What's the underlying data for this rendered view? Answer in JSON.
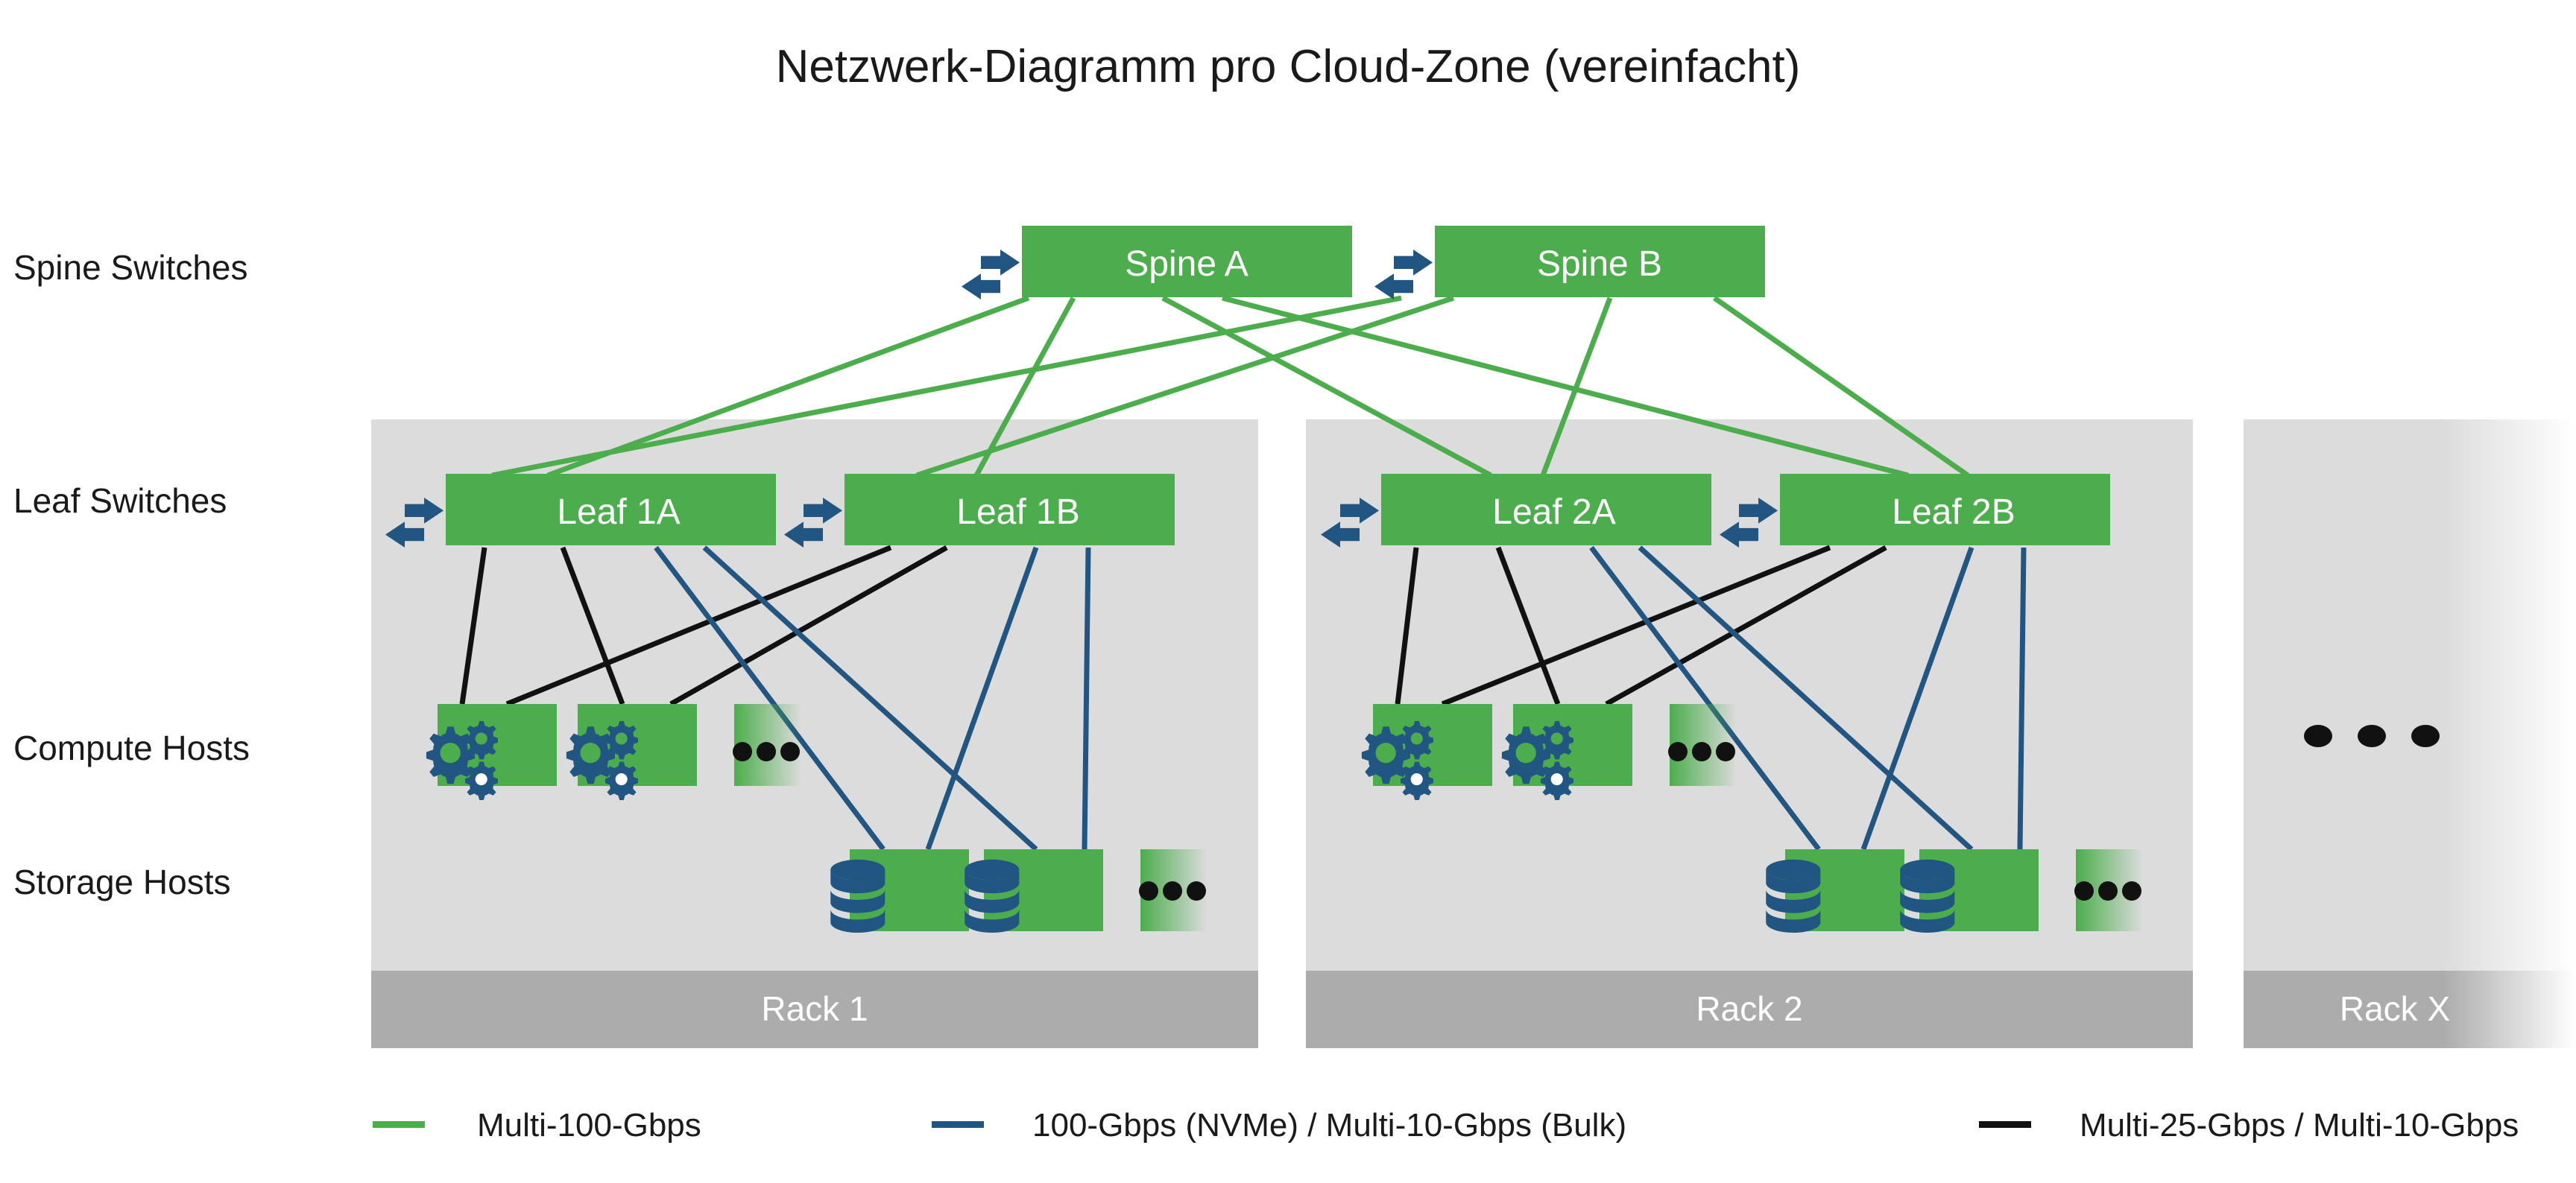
{
  "title": "Netzwerk-Diagramm pro Cloud-Zone (vereinfacht)",
  "colors": {
    "green": "#4CAD4C",
    "blue": "#215582",
    "black": "#111111",
    "rack_body": "#DCDCDC",
    "rack_footer": "#ACACAC",
    "background": "#FFFFFF",
    "text": "#1A1A1A"
  },
  "row_labels": [
    {
      "id": "spine",
      "label": "Spine Switches"
    },
    {
      "id": "leaf",
      "label": "Leaf Switches"
    },
    {
      "id": "compute",
      "label": "Compute Hosts"
    },
    {
      "id": "storage",
      "label": "Storage Hosts"
    }
  ],
  "spines": [
    {
      "id": "spine-a",
      "label": "Spine A"
    },
    {
      "id": "spine-b",
      "label": "Spine B"
    }
  ],
  "racks": [
    {
      "id": "rack-1",
      "label": "Rack 1",
      "faded": false,
      "leaves": [
        {
          "id": "leaf-1a",
          "label": "Leaf 1A"
        },
        {
          "id": "leaf-1b",
          "label": "Leaf 1B"
        }
      ],
      "compute_hosts": [
        {
          "id": "compute-1-1",
          "icon": "gears-icon"
        },
        {
          "id": "compute-1-2",
          "icon": "gears-icon"
        },
        {
          "id": "compute-1-more",
          "icon": "ellipsis-icon"
        }
      ],
      "storage_hosts": [
        {
          "id": "storage-1-1",
          "icon": "database-icon"
        },
        {
          "id": "storage-1-2",
          "icon": "database-icon"
        },
        {
          "id": "storage-1-more",
          "icon": "ellipsis-icon"
        }
      ]
    },
    {
      "id": "rack-2",
      "label": "Rack 2",
      "faded": false,
      "leaves": [
        {
          "id": "leaf-2a",
          "label": "Leaf 2A"
        },
        {
          "id": "leaf-2b",
          "label": "Leaf 2B"
        }
      ],
      "compute_hosts": [
        {
          "id": "compute-2-1",
          "icon": "gears-icon"
        },
        {
          "id": "compute-2-2",
          "icon": "gears-icon"
        },
        {
          "id": "compute-2-more",
          "icon": "ellipsis-icon"
        }
      ],
      "storage_hosts": [
        {
          "id": "storage-2-1",
          "icon": "database-icon"
        },
        {
          "id": "storage-2-2",
          "icon": "database-icon"
        },
        {
          "id": "storage-2-more",
          "icon": "ellipsis-icon"
        }
      ]
    },
    {
      "id": "rack-x",
      "label": "Rack X",
      "faded": true,
      "leaves": [],
      "compute_hosts": [],
      "storage_hosts": [],
      "ellipsis": "ellipsis-icon"
    }
  ],
  "legend": [
    {
      "id": "legend-100g",
      "label": "Multi-100-Gbps",
      "color": "#4CAD4C"
    },
    {
      "id": "legend-nvme",
      "label": "100-Gbps (NVMe) / Multi-10-Gbps (Bulk)",
      "color": "#215582"
    },
    {
      "id": "legend-25g",
      "label": "Multi-25-Gbps / Multi-10-Gbps",
      "color": "#111111"
    }
  ],
  "chart_data": {
    "type": "diagram",
    "title": "Netzwerk-Diagramm pro Cloud-Zone (vereinfacht)",
    "tiers": [
      "Spine Switches",
      "Leaf Switches",
      "Compute Hosts",
      "Storage Hosts"
    ],
    "nodes": [
      "Spine A",
      "Spine B",
      "Leaf 1A",
      "Leaf 1B",
      "Leaf 2A",
      "Leaf 2B",
      "Rack 1",
      "Rack 2",
      "Rack X"
    ],
    "links": [
      {
        "from": "Spine A",
        "to": "Leaf 1A",
        "class": "Multi-100-Gbps"
      },
      {
        "from": "Spine A",
        "to": "Leaf 1B",
        "class": "Multi-100-Gbps"
      },
      {
        "from": "Spine A",
        "to": "Leaf 2A",
        "class": "Multi-100-Gbps"
      },
      {
        "from": "Spine A",
        "to": "Leaf 2B",
        "class": "Multi-100-Gbps"
      },
      {
        "from": "Spine B",
        "to": "Leaf 1A",
        "class": "Multi-100-Gbps"
      },
      {
        "from": "Spine B",
        "to": "Leaf 1B",
        "class": "Multi-100-Gbps"
      },
      {
        "from": "Spine B",
        "to": "Leaf 2A",
        "class": "Multi-100-Gbps"
      },
      {
        "from": "Spine B",
        "to": "Leaf 2B",
        "class": "Multi-100-Gbps"
      },
      {
        "from": "Leaf 1A",
        "to": "Compute 1-1",
        "class": "Multi-25-Gbps / Multi-10-Gbps"
      },
      {
        "from": "Leaf 1A",
        "to": "Compute 1-2",
        "class": "Multi-25-Gbps / Multi-10-Gbps"
      },
      {
        "from": "Leaf 1B",
        "to": "Compute 1-1",
        "class": "Multi-25-Gbps / Multi-10-Gbps"
      },
      {
        "from": "Leaf 1B",
        "to": "Compute 1-2",
        "class": "Multi-25-Gbps / Multi-10-Gbps"
      },
      {
        "from": "Leaf 1A",
        "to": "Storage 1-1",
        "class": "100-Gbps (NVMe) / Multi-10-Gbps (Bulk)"
      },
      {
        "from": "Leaf 1A",
        "to": "Storage 1-2",
        "class": "100-Gbps (NVMe) / Multi-10-Gbps (Bulk)"
      },
      {
        "from": "Leaf 1B",
        "to": "Storage 1-1",
        "class": "100-Gbps (NVMe) / Multi-10-Gbps (Bulk)"
      },
      {
        "from": "Leaf 1B",
        "to": "Storage 1-2",
        "class": "100-Gbps (NVMe) / Multi-10-Gbps (Bulk)"
      },
      {
        "from": "Leaf 2A",
        "to": "Compute 2-1",
        "class": "Multi-25-Gbps / Multi-10-Gbps"
      },
      {
        "from": "Leaf 2A",
        "to": "Compute 2-2",
        "class": "Multi-25-Gbps / Multi-10-Gbps"
      },
      {
        "from": "Leaf 2B",
        "to": "Compute 2-1",
        "class": "Multi-25-Gbps / Multi-10-Gbps"
      },
      {
        "from": "Leaf 2B",
        "to": "Compute 2-2",
        "class": "Multi-25-Gbps / Multi-10-Gbps"
      },
      {
        "from": "Leaf 2A",
        "to": "Storage 2-1",
        "class": "100-Gbps (NVMe) / Multi-10-Gbps (Bulk)"
      },
      {
        "from": "Leaf 2A",
        "to": "Storage 2-2",
        "class": "100-Gbps (NVMe) / Multi-10-Gbps (Bulk)"
      },
      {
        "from": "Leaf 2B",
        "to": "Storage 2-1",
        "class": "100-Gbps (NVMe) / Multi-10-Gbps (Bulk)"
      },
      {
        "from": "Leaf 2B",
        "to": "Storage 2-2",
        "class": "100-Gbps (NVMe) / Multi-10-Gbps (Bulk)"
      }
    ],
    "legend": [
      "Multi-100-Gbps",
      "100-Gbps (NVMe) / Multi-10-Gbps (Bulk)",
      "Multi-25-Gbps / Multi-10-Gbps"
    ]
  }
}
